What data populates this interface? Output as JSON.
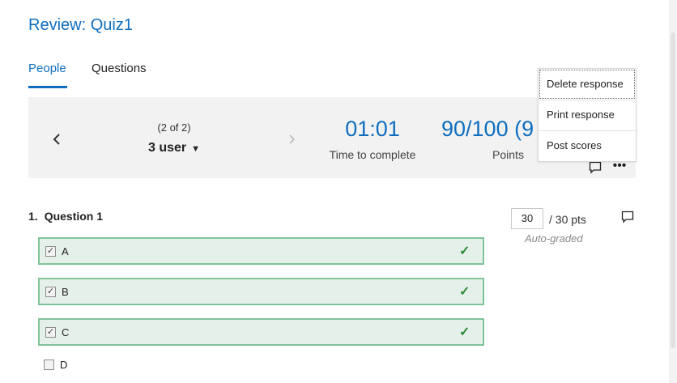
{
  "page": {
    "title": "Review: Quiz1"
  },
  "tabs": [
    {
      "label": "People",
      "active": true
    },
    {
      "label": "Questions",
      "active": false
    }
  ],
  "summary": {
    "prev_icon": "chevron-left-icon",
    "next_icon": "chevron-right-icon",
    "counter": "(2 of 2)",
    "user": "3 user",
    "user_caret": "▼",
    "time_value": "01:01",
    "time_label": "Time to complete",
    "points_value": "90/100 (9",
    "points_label": "Points",
    "comment_icon": "comment-icon",
    "more_icon": "more-icon",
    "more_glyph": "•••"
  },
  "menu": {
    "items": [
      "Delete response",
      "Print response",
      "Post scores"
    ]
  },
  "question": {
    "number": "1.",
    "title": "Question 1",
    "score": "30",
    "total": "/ 30 pts",
    "graded": "Auto-graded",
    "options": [
      {
        "label": "A",
        "checked": true,
        "correct": true
      },
      {
        "label": "B",
        "checked": true,
        "correct": true
      },
      {
        "label": "C",
        "checked": true,
        "correct": true
      },
      {
        "label": "D",
        "checked": false,
        "correct": false
      }
    ]
  },
  "colors": {
    "accent": "#106ebe",
    "correct_border": "#7dc49a",
    "correct_bg": "#e6f0ea",
    "check": "#2e8b3a"
  }
}
